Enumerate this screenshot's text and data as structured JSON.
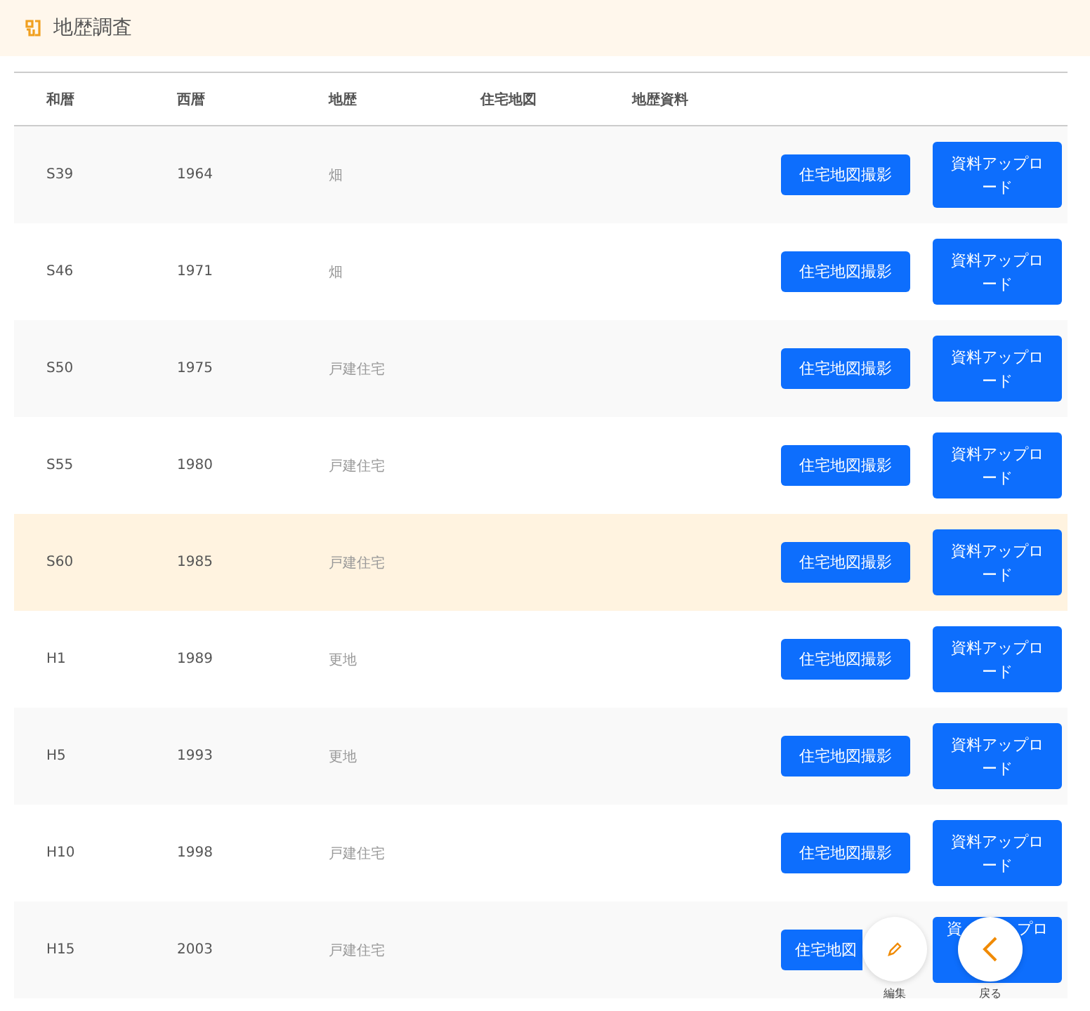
{
  "header": {
    "title": "地歴調査"
  },
  "table": {
    "columns": [
      "和暦",
      "西暦",
      "地歴",
      "住宅地図",
      "地歴資料"
    ],
    "rows": [
      {
        "wareki": "S39",
        "seireki": "1964",
        "history": "畑",
        "map_button": "住宅地図撮影",
        "upload_button": "資料アップロード",
        "selected": false
      },
      {
        "wareki": "S46",
        "seireki": "1971",
        "history": "畑",
        "map_button": "住宅地図撮影",
        "upload_button": "資料アップロード",
        "selected": false
      },
      {
        "wareki": "S50",
        "seireki": "1975",
        "history": "戸建住宅",
        "map_button": "住宅地図撮影",
        "upload_button": "資料アップロード",
        "selected": false
      },
      {
        "wareki": "S55",
        "seireki": "1980",
        "history": "戸建住宅",
        "map_button": "住宅地図撮影",
        "upload_button": "資料アップロード",
        "selected": false
      },
      {
        "wareki": "S60",
        "seireki": "1985",
        "history": "戸建住宅",
        "map_button": "住宅地図撮影",
        "upload_button": "資料アップロード",
        "selected": true
      },
      {
        "wareki": "H1",
        "seireki": "1989",
        "history": "更地",
        "map_button": "住宅地図撮影",
        "upload_button": "資料アップロード",
        "selected": false
      },
      {
        "wareki": "H5",
        "seireki": "1993",
        "history": "更地",
        "map_button": "住宅地図撮影",
        "upload_button": "資料アップロード",
        "selected": false
      },
      {
        "wareki": "H10",
        "seireki": "1998",
        "history": "戸建住宅",
        "map_button": "住宅地図撮影",
        "upload_button": "資料アップロード",
        "selected": false
      },
      {
        "wareki": "H15",
        "seireki": "2003",
        "history": "戸建住宅",
        "map_button": "住宅地図",
        "upload_button": [
          "資",
          "プロ"
        ],
        "selected": false
      }
    ]
  },
  "floating_actions": [
    {
      "kind": "edit",
      "label": "編集"
    },
    {
      "kind": "back",
      "label": "戻る"
    }
  ]
}
